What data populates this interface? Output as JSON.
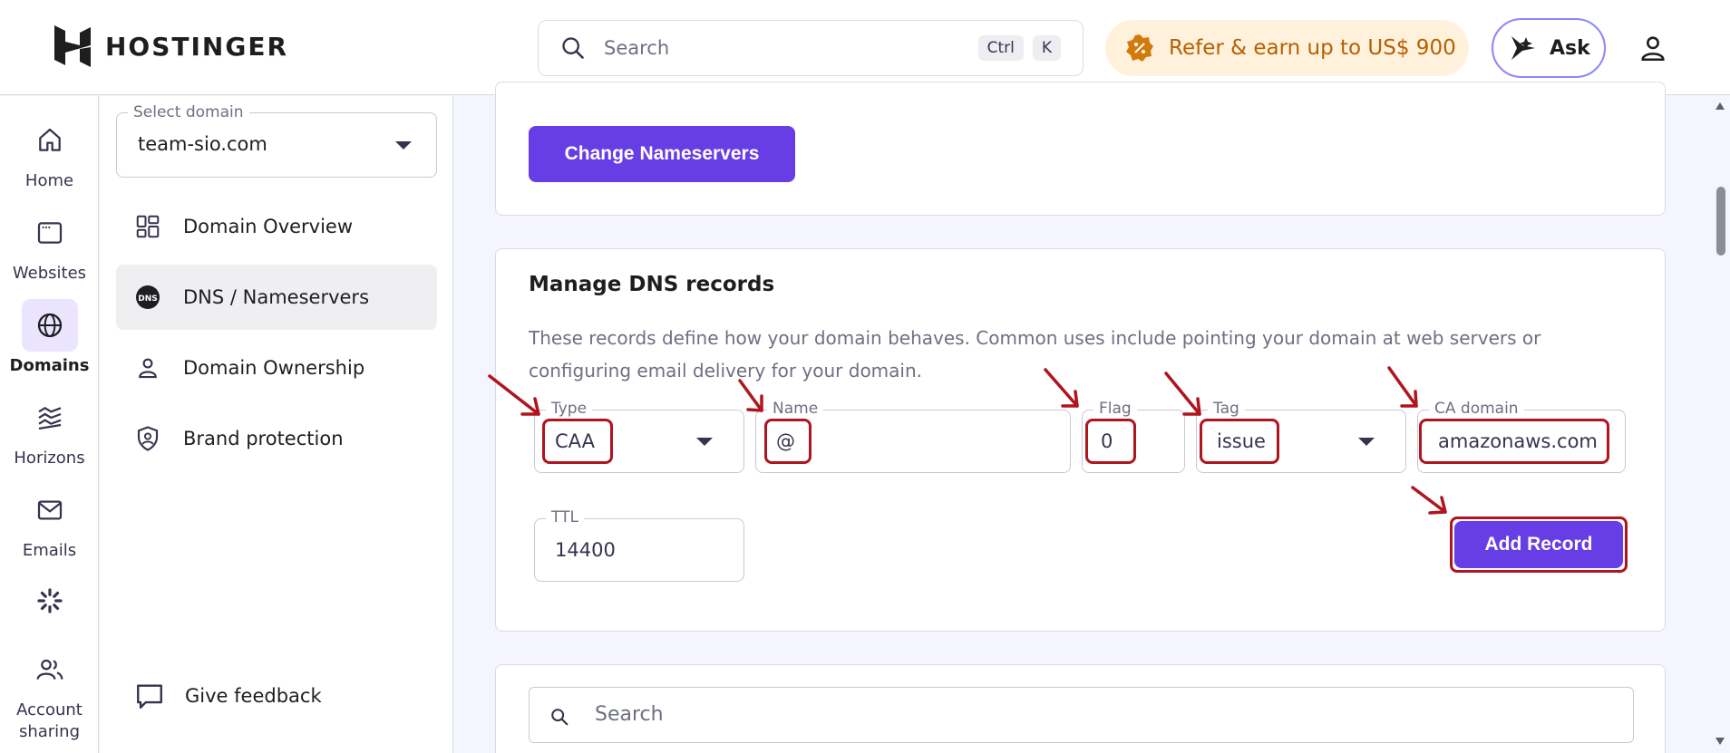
{
  "brand": {
    "name": "HOSTINGER"
  },
  "header": {
    "search_placeholder": "Search",
    "shortcut_ctrl": "Ctrl",
    "shortcut_k": "K",
    "refer_text": "Refer & earn up to US$ 900",
    "ask_label": "Ask"
  },
  "rail": {
    "items": [
      {
        "label": "Home",
        "icon": "home-icon"
      },
      {
        "label": "Websites",
        "icon": "browser-icon"
      },
      {
        "label": "Domains",
        "icon": "globe-icon",
        "active": true
      },
      {
        "label": "Horizons",
        "icon": "horizons-icon"
      },
      {
        "label": "Emails",
        "icon": "mail-icon"
      },
      {
        "label": "",
        "icon": "loading-icon"
      },
      {
        "label": "Account sharing",
        "icon": "users-icon"
      }
    ]
  },
  "sidebar": {
    "select_label": "Select domain",
    "selected_domain": "team-sio.com",
    "items": [
      {
        "label": "Domain Overview",
        "icon": "grid-icon"
      },
      {
        "label": "DNS / Nameservers",
        "icon": "dns-icon",
        "active": true
      },
      {
        "label": "Domain Ownership",
        "icon": "person-icon"
      },
      {
        "label": "Brand protection",
        "icon": "shield-icon"
      }
    ],
    "feedback_label": "Give feedback"
  },
  "nameservers": {
    "change_button": "Change Nameservers"
  },
  "dns": {
    "title": "Manage DNS records",
    "description": "These records define how your domain behaves. Common uses include pointing your domain at web servers or configuring email delivery for your domain.",
    "fields": {
      "type": {
        "label": "Type",
        "value": "CAA"
      },
      "name": {
        "label": "Name",
        "value": "@"
      },
      "flag": {
        "label": "Flag",
        "value": "0"
      },
      "tag": {
        "label": "Tag",
        "value": "issue"
      },
      "ca_domain": {
        "label": "CA domain",
        "value": "amazonaws.com"
      },
      "ttl": {
        "label": "TTL",
        "value": "14400"
      }
    },
    "add_button": "Add Record"
  },
  "records": {
    "search_placeholder": "Search"
  },
  "colors": {
    "accent": "#673de6",
    "annotation": "#b0141e"
  }
}
